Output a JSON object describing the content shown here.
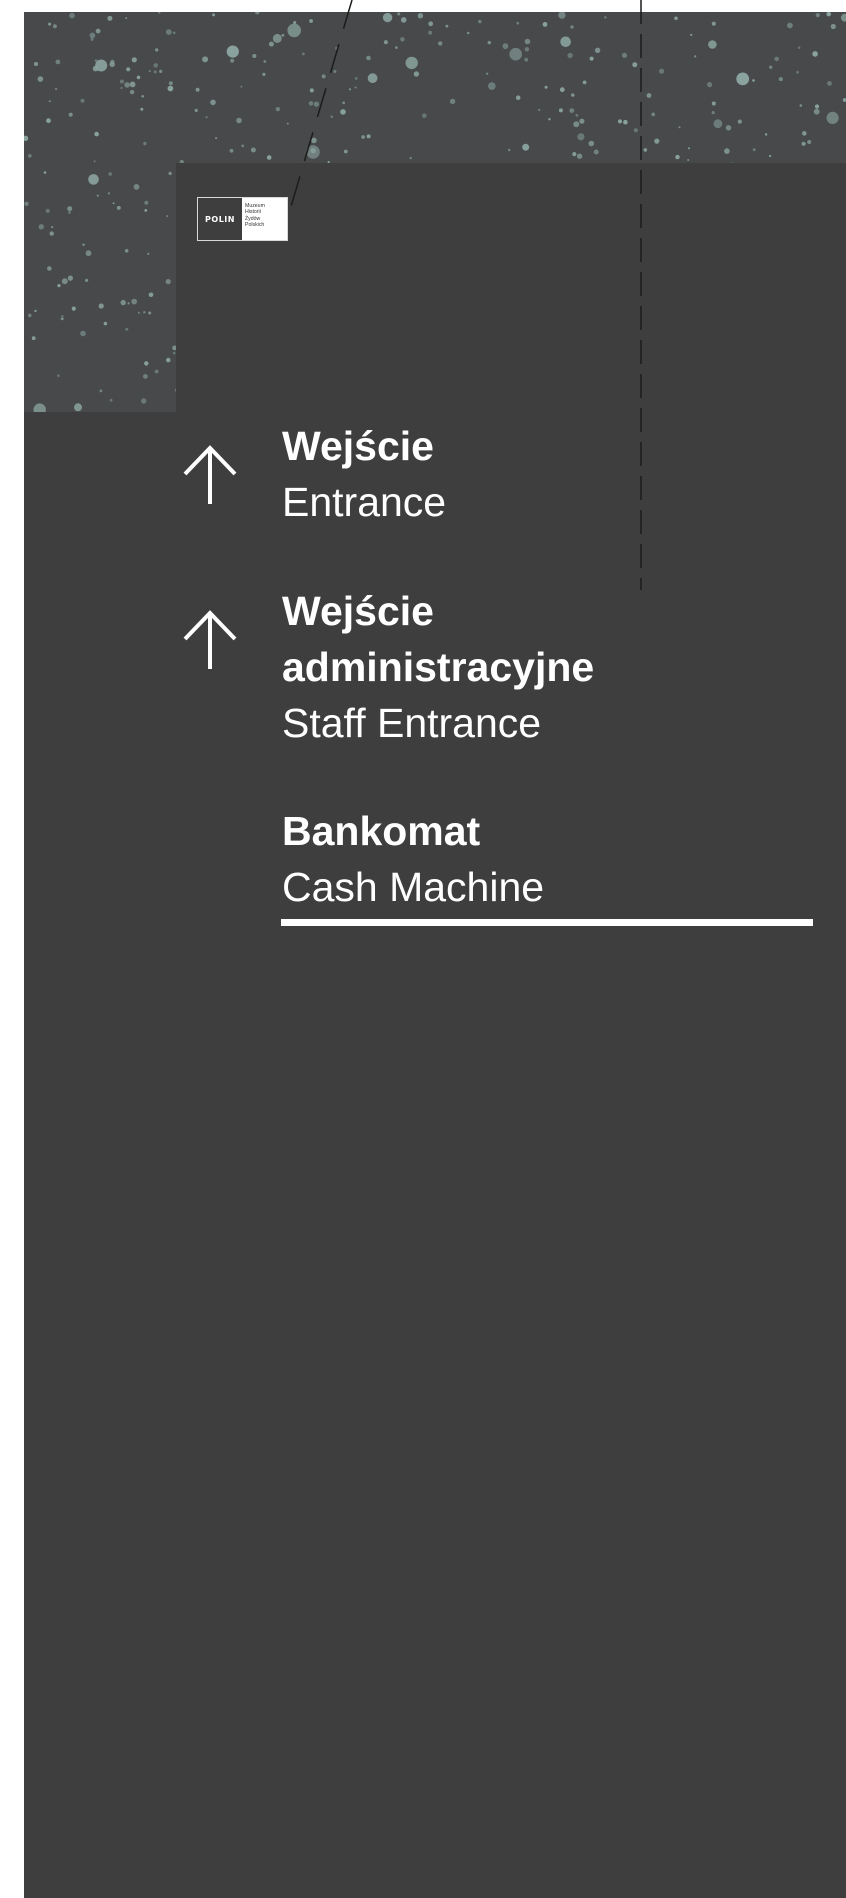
{
  "logo": {
    "mark": "POLIN",
    "lines": [
      "Muzeum",
      "Historii",
      "Żydów",
      "Polskich"
    ]
  },
  "sign": {
    "entries": [
      {
        "polish": "Wejście",
        "english": "Entrance",
        "icon": "arrow-up-icon"
      },
      {
        "polish": "Wejście administracyjne",
        "english": "Staff Entrance",
        "icon": "arrow-up-icon"
      },
      {
        "polish": "Bankomat",
        "english": "Cash Machine",
        "icon": null
      }
    ]
  },
  "colors": {
    "background": "#3e3e3e",
    "pattern_dots": "#8aa39e",
    "text": "#ffffff"
  }
}
